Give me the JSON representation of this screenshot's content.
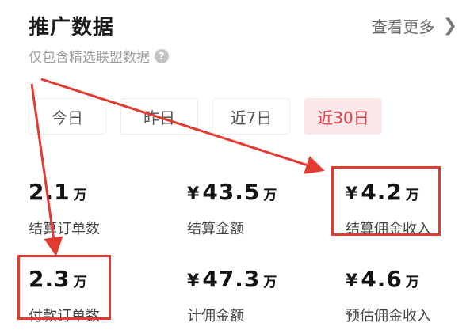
{
  "header": {
    "title": "推广数据",
    "more_label": "查看更多",
    "subtitle": "仅包含精选联盟数据",
    "help_icon": "question-circle-icon",
    "more_icon": "chevron-right-icon"
  },
  "tabs": [
    {
      "label": "今日",
      "active": false
    },
    {
      "label": "昨日",
      "active": false
    },
    {
      "label": "近7日",
      "active": false
    },
    {
      "label": "近30日",
      "active": true
    }
  ],
  "metrics": [
    {
      "currency": "",
      "value": "2.1",
      "unit": "万",
      "label": "结算订单数"
    },
    {
      "currency": "¥",
      "value": "43.5",
      "unit": "万",
      "label": "结算金额"
    },
    {
      "currency": "¥",
      "value": "4.2",
      "unit": "万",
      "label": "结算佣金收入"
    },
    {
      "currency": "",
      "value": "2.3",
      "unit": "万",
      "label": "付款订单数"
    },
    {
      "currency": "¥",
      "value": "47.3",
      "unit": "万",
      "label": "计佣金额"
    },
    {
      "currency": "¥",
      "value": "4.6",
      "unit": "万",
      "label": "预估佣金收入"
    }
  ],
  "annotations": {
    "color": "#e23b32",
    "highlighted_metrics": [
      "结算佣金收入",
      "付款订单数"
    ]
  },
  "colors": {
    "accent": "#e8394a",
    "active_tab_bg": "#fbe9ea"
  }
}
